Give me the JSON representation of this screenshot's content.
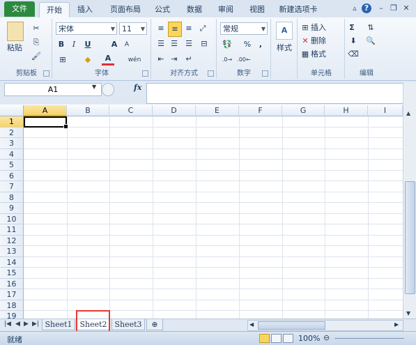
{
  "tabs": {
    "file": "文件",
    "items": [
      "开始",
      "插入",
      "页面布局",
      "公式",
      "数据",
      "审阅",
      "视图",
      "新建选项卡"
    ]
  },
  "ribbon": {
    "clipboard": {
      "label": "剪贴板",
      "paste": "粘贴"
    },
    "font": {
      "label": "字体",
      "family": "宋体",
      "size": "11",
      "bold": "B",
      "italic": "I",
      "underline": "U",
      "grow": "A",
      "shrink": "A",
      "color_letter": "A",
      "phonetic": "wén"
    },
    "alignment": {
      "label": "对齐方式"
    },
    "number": {
      "label": "数字",
      "format": "常规",
      "percent": "%",
      "comma": ","
    },
    "styles": {
      "label": "样式",
      "styles_btn": "样式"
    },
    "cells": {
      "label": "单元格",
      "insert": "插入",
      "delete": "删除",
      "format": "格式"
    },
    "editing": {
      "label": "编辑",
      "sum": "Σ"
    }
  },
  "formula_bar": {
    "name_box": "A1",
    "fx": "fx",
    "content": ""
  },
  "columns": [
    "A",
    "B",
    "C",
    "D",
    "E",
    "F",
    "G",
    "H",
    "I"
  ],
  "rows": [
    "1",
    "2",
    "3",
    "4",
    "5",
    "6",
    "7",
    "8",
    "9",
    "10",
    "11",
    "12",
    "13",
    "14",
    "15",
    "16",
    "17",
    "18",
    "19"
  ],
  "sheets": [
    "Sheet1",
    "Sheet2",
    "Sheet3"
  ],
  "status": {
    "ready": "就绪",
    "zoom": "100%"
  },
  "colors": {
    "file_tab": "#2b8a3e",
    "highlight_box": "#e53935",
    "selected_header": "#f6d36a"
  }
}
